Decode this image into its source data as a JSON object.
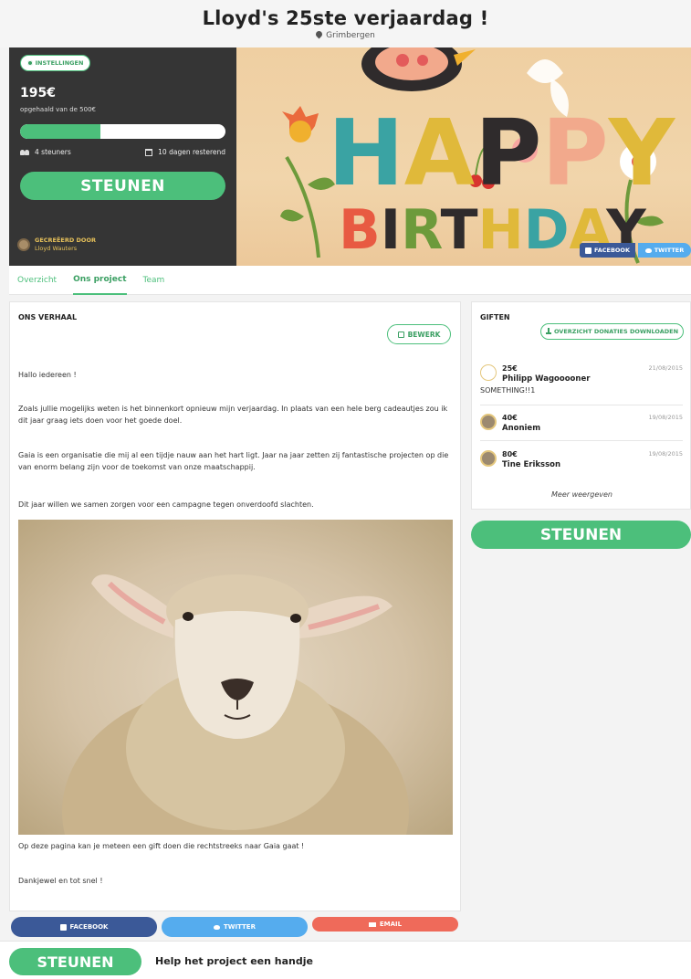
{
  "header": {
    "title": "Lloyd's 25ste verjaardag !",
    "location": "Grimbergen"
  },
  "campaign": {
    "settings_label": "INSTELLINGEN",
    "raised": "195€",
    "raised_sub": "opgehaald van de 500€",
    "progress_fraction": 0.39,
    "supporters": "4 steuners",
    "days_left": "10 dagen resterend",
    "cta_label": "STEUNEN",
    "created_by_label": "GECREËERD DOOR",
    "creator_name": "Lloyd Wauters",
    "share_facebook": "FACEBOOK",
    "share_twitter": "TWITTER"
  },
  "tabs": [
    {
      "label": "Overzicht"
    },
    {
      "label": "Ons project"
    },
    {
      "label": "Team"
    }
  ],
  "story": {
    "heading": "ONS VERHAAL",
    "edit_label": "BEWERK",
    "paragraphs": [
      "Hallo iedereen !",
      "Zoals jullie mogelijks weten is het binnenkort opnieuw mijn verjaardag. In plaats van een hele berg cadeautjes zou ik dit jaar graag iets doen voor het goede doel.",
      "Gaia is een organisatie die mij al een tijdje nauw aan het hart ligt. Jaar na jaar zetten zij fantastische projecten op die van enorm belang zijn voor de toekomst van onze maatschappij.",
      "Dit jaar willen we samen zorgen voor een campagne tegen onverdoofd slachten.",
      "Op deze pagina kan je meteen een gift doen die rechtstreeks naar Gaia gaat !",
      "Dankjewel en tot snel !"
    ]
  },
  "share_bar": {
    "facebook": "FACEBOOK",
    "twitter": "TWITTER",
    "email": "EMAIL"
  },
  "gifts": {
    "heading": "GIFTEN",
    "download_label": "OVERZICHT DONATIES DOWNLOADEN",
    "items": [
      {
        "amount": "25€",
        "date": "21/08/2015",
        "name": "Philipp Wagooooner",
        "message": "SOMETHING!!1"
      },
      {
        "amount": "40€",
        "date": "19/08/2015",
        "name": "Anoniem",
        "message": ""
      },
      {
        "amount": "80€",
        "date": "19/08/2015",
        "name": "Tine Eriksson",
        "message": ""
      }
    ],
    "more_label": "Meer weergeven"
  },
  "sidebar_cta": "STEUNEN",
  "bottom_bar": {
    "cta_label": "STEUNEN",
    "text": "Help het project een handje"
  },
  "hero_image": {
    "word1": "HAPPY",
    "word2": "BIRTHDAY"
  },
  "colors": {
    "accent": "#4cbf7b",
    "dark_panel": "#353535",
    "facebook": "#3b5998",
    "twitter": "#55acee",
    "email": "#ef6a5a"
  }
}
